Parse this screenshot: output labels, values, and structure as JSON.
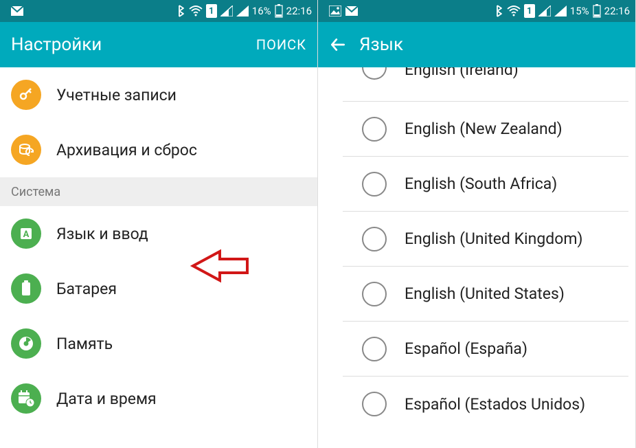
{
  "left": {
    "statusbar": {
      "icons": {
        "gmail": "gmail-icon",
        "bluetooth": "bluetooth-icon",
        "wifi": "wifi-icon",
        "sim": "1",
        "signal1": "signal-icon",
        "signal2": "signal-icon",
        "battery": "battery-icon"
      },
      "battery_pct": "16%",
      "time": "22:16"
    },
    "appbar": {
      "title": "Настройки",
      "search": "ПОИСК"
    },
    "items": [
      {
        "label": "Учетные записи"
      },
      {
        "label": "Архивация и сброс"
      }
    ],
    "section": "Система",
    "system_items": [
      {
        "label": "Язык и ввод"
      },
      {
        "label": "Батарея"
      },
      {
        "label": "Память"
      },
      {
        "label": "Дата и время"
      }
    ]
  },
  "right": {
    "statusbar": {
      "icons": {
        "picture": "picture-icon",
        "gmail": "gmail-icon",
        "bluetooth": "bluetooth-icon",
        "wifi": "wifi-icon",
        "sim": "1",
        "signal1": "signal-icon",
        "signal2": "signal-icon",
        "battery": "battery-icon"
      },
      "battery_pct": "15%",
      "time": "22:16"
    },
    "appbar": {
      "title": "Язык"
    },
    "languages": [
      "English (Ireland)",
      "English (New Zealand)",
      "English (South Africa)",
      "English (United Kingdom)",
      "English (United States)",
      "Español (España)",
      "Español (Estados Unidos)"
    ]
  },
  "colors": {
    "statusbar": "#0b7e89",
    "appbar": "#00aabc",
    "orange": "#f5a623",
    "green": "#4caf50",
    "arrow": "#d11717"
  }
}
